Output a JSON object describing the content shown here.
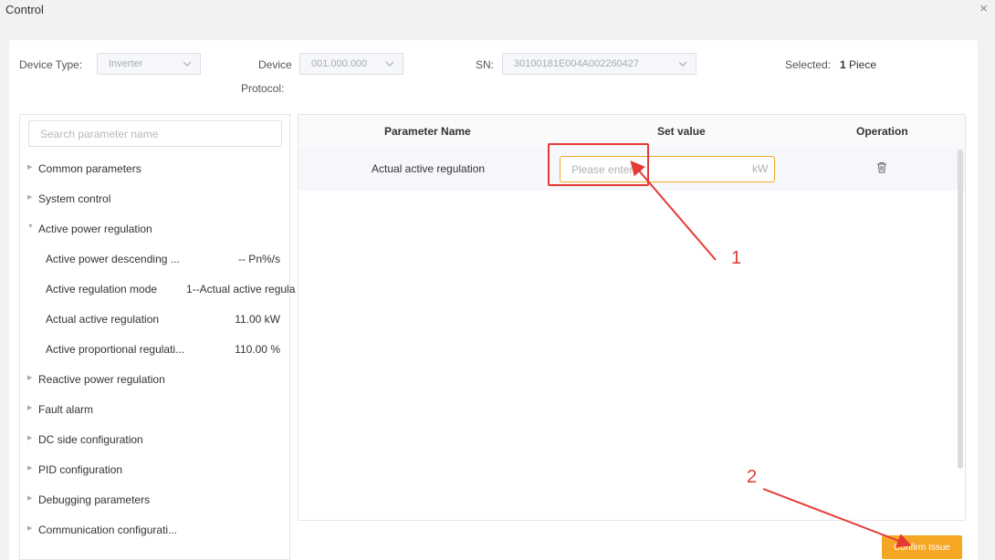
{
  "window": {
    "title": "Control",
    "close_glyph": "×"
  },
  "filters": {
    "device_type_label": "Device Type:",
    "device_type_value": "Inverter",
    "protocol_label_1": "Device",
    "protocol_label_2": "Protocol:",
    "protocol_value": "001.000.000",
    "sn_label": "SN:",
    "sn_value": "30100181E004A002260427",
    "selected_label": "Selected:",
    "selected_count": "1",
    "selected_unit": "Piece"
  },
  "search": {
    "placeholder": "Search parameter name"
  },
  "tree": {
    "common": "Common parameters",
    "system": "System control",
    "active": "Active power regulation",
    "children": [
      {
        "name": "Active power descending ...",
        "value": "-- Pn%/s"
      },
      {
        "name": "Active regulation mode",
        "value": "1--Actual active regula"
      },
      {
        "name": "Actual active regulation",
        "value": "11.00 kW"
      },
      {
        "name": "Active proportional regulati...",
        "value": "110.00 %"
      }
    ],
    "reactive": "Reactive power regulation",
    "fault": "Fault alarm",
    "dc": "DC side configuration",
    "pid": "PID configuration",
    "debug": "Debugging parameters",
    "comm": "Communication configurati..."
  },
  "table": {
    "headers": {
      "name": "Parameter Name",
      "set_value": "Set value",
      "operation": "Operation"
    },
    "rows": [
      {
        "name": "Actual active regulation",
        "placeholder": "Please enter",
        "unit": "kW"
      }
    ]
  },
  "actions": {
    "confirm": "Confirm Issue"
  },
  "annotations": {
    "label_1": "1",
    "label_2": "2"
  },
  "colors": {
    "accent": "#f5a623",
    "annotation": "#e53935"
  },
  "icons": {
    "close": "close-icon",
    "chevron": "chevron-down-icon",
    "tree_arrow": "caret-right-icon",
    "delete": "trash-icon"
  }
}
